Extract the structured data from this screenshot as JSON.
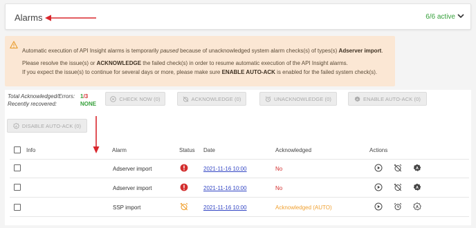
{
  "header": {
    "title": "Alarms",
    "active_count": "6/6 active"
  },
  "alert": {
    "line1_prefix": "Automatic execution of API Insight alarms is temporarily ",
    "line1_paused": "paused",
    "line1_mid": " because of unacknowledged system alarm checks(s) of types(s) ",
    "line1_type": "Adserver import",
    "line1_end": ".",
    "line2_prefix": "Please resolve the issue(s) or ",
    "line2_ack": "ACKNOWLEDGE",
    "line2_end": " the failed check(s) in order to resume automatic execution of the API Insight alarms.",
    "line3_prefix": "If you expect the issue(s) to continue for several days or more, please make sure ",
    "line3_enable": "ENABLE AUTO-ACK",
    "line3_end": " is enabled for the failed system check(s)."
  },
  "stats": {
    "total_label": "Total Acknowledged/Errors:",
    "total_ack": "1",
    "total_sep": "/",
    "total_err": "3",
    "recovered_label": "Recently recovered:",
    "recovered_value": "NONE"
  },
  "toolbar": {
    "check_now": "CHECK NOW (0)",
    "acknowledge": "ACKNOWLEDGE (0)",
    "unacknowledge": "UNACKNOWLEDGE (0)",
    "enable_auto_ack": "ENABLE AUTO-ACK (0)",
    "disable_auto_ack": "DISABLE AUTO-ACK (0)"
  },
  "table": {
    "columns": {
      "info": "Info",
      "alarm": "Alarm",
      "status": "Status",
      "date": "Date",
      "acknowledged": "Acknowledged",
      "actions": "Actions"
    },
    "rows": [
      {
        "alarm": "Adserver import",
        "status": "error",
        "date": "2021-11-16 10:00",
        "acknowledged": "No"
      },
      {
        "alarm": "Adserver import",
        "status": "error",
        "date": "2021-11-16 10:00",
        "acknowledged": "No"
      },
      {
        "alarm": "SSP import",
        "status": "alarm-acknowledged",
        "date": "2021-11-16 10:00",
        "acknowledged": "Acknowledged (AUTO)"
      }
    ]
  },
  "colors": {
    "active_green": "#35a03a",
    "error_red": "#d32f2f",
    "auto_orange": "#f0a030",
    "alert_bg": "#fbe7d4",
    "annotation_arrow": "#d9262c"
  }
}
